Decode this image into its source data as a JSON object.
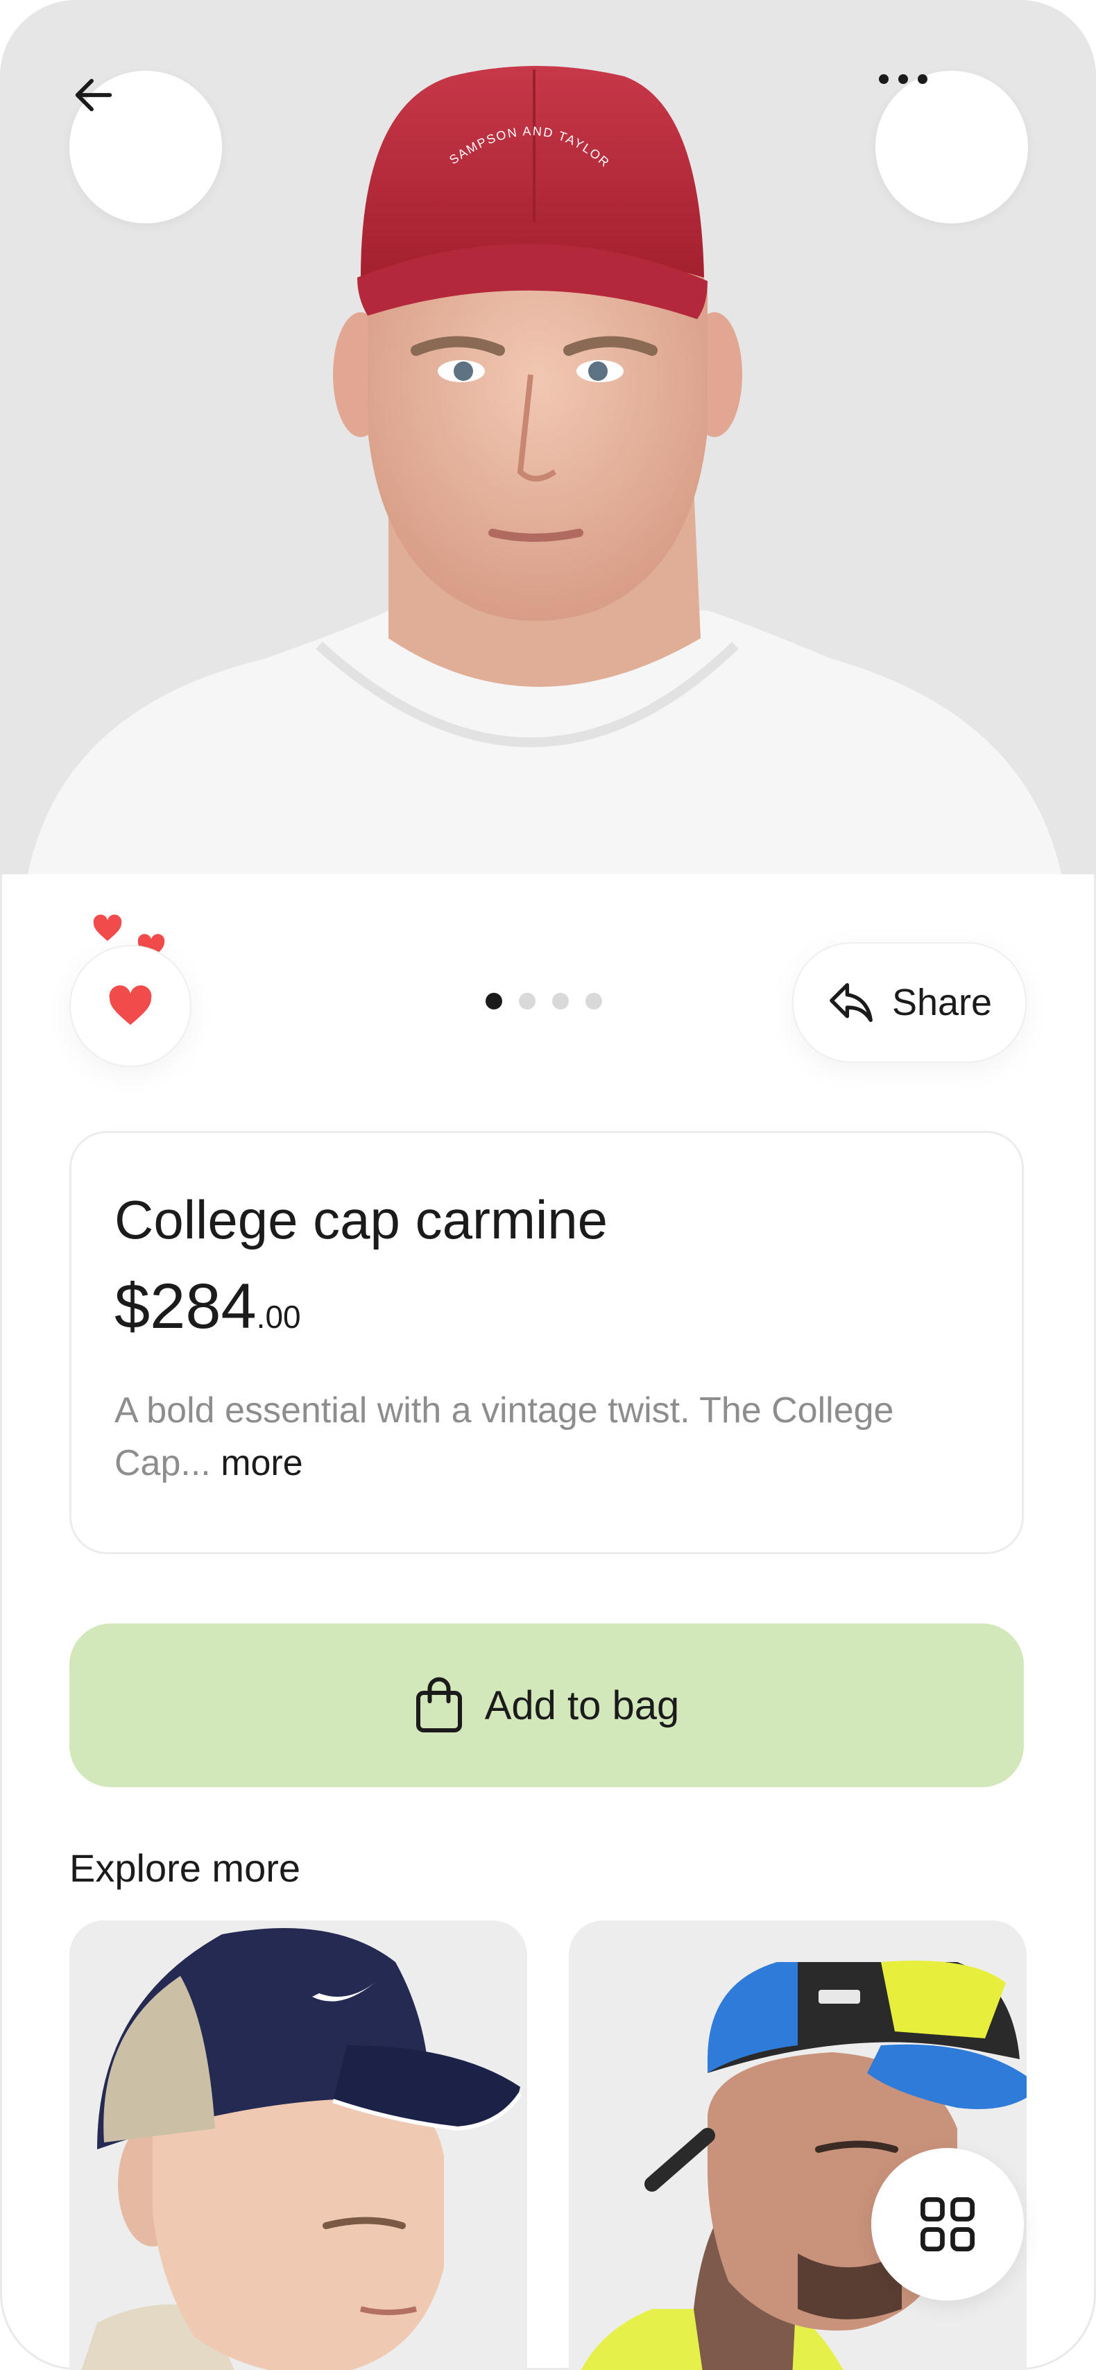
{
  "hero": {
    "cap_print": "SAMPSON AND TAYLOR",
    "back_icon": "arrow-left-icon",
    "more_icon": "ellipsis-icon"
  },
  "actions": {
    "like_icon": "heart-icon",
    "liked": true,
    "accent_color": "#f24b4b",
    "carousel": {
      "count": 4,
      "active": 1
    },
    "share_label": "Share",
    "share_icon": "share-arrow-icon"
  },
  "product": {
    "title": "College cap carmine",
    "price_main": "$284",
    "price_cents": ".00",
    "description": "A bold essential with a vintage twist. The College Cap...",
    "more_label": "more"
  },
  "cta": {
    "label": "Add to bag",
    "icon": "shopping-bag-icon",
    "color": "#d2e8bb"
  },
  "explore": {
    "title": "Explore more",
    "grid_icon": "grid-icon"
  }
}
